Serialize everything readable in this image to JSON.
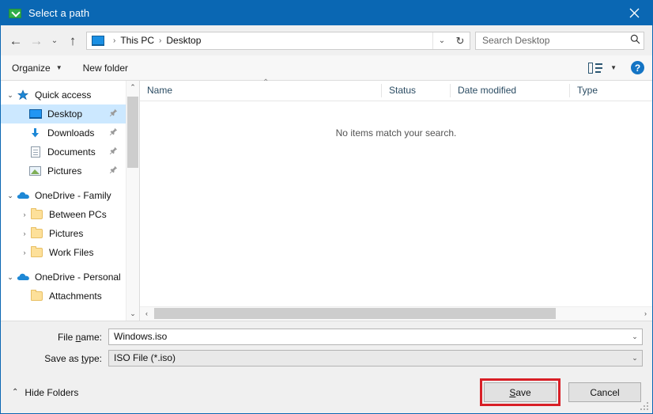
{
  "window": {
    "title": "Select a path",
    "icon": "save-arrow-icon",
    "close_label": "✕",
    "title_bar_color": "#0a67b3"
  },
  "address_bar": {
    "back_icon": "←",
    "forward_icon": "→",
    "recent_icon": "⌄",
    "up_icon": "↑",
    "breadcrumb": {
      "root_icon": "this-pc-monitor-icon",
      "separator": "›",
      "items": [
        "This PC",
        "Desktop"
      ]
    },
    "dropdown_icon": "⌄",
    "refresh_icon": "↻",
    "search": {
      "placeholder": "Search Desktop",
      "value": "",
      "icon": "⌕"
    }
  },
  "toolbar": {
    "organize_label": "Organize",
    "organize_caret": "▼",
    "new_folder_label": "New folder",
    "view_icon": "view-details-icon",
    "view_caret": "▼",
    "help_label": "?"
  },
  "sidebar": {
    "scroll_up_icon": "⌃",
    "scroll_down_icon": "⌄",
    "items": [
      {
        "label": "Quick access",
        "icon": "star-icon",
        "expander": "⌄",
        "indent": 0,
        "selected": false,
        "pinned": false
      },
      {
        "label": "Desktop",
        "icon": "monitor-icon",
        "expander": "",
        "indent": 1,
        "selected": true,
        "pinned": true
      },
      {
        "label": "Downloads",
        "icon": "download-icon",
        "expander": "",
        "indent": 1,
        "selected": false,
        "pinned": true
      },
      {
        "label": "Documents",
        "icon": "document-icon",
        "expander": "",
        "indent": 1,
        "selected": false,
        "pinned": true
      },
      {
        "label": "Pictures",
        "icon": "picture-icon",
        "expander": "",
        "indent": 1,
        "selected": false,
        "pinned": true
      },
      {
        "label": "OneDrive - Family",
        "icon": "cloud-icon",
        "expander": "⌄",
        "indent": 0,
        "selected": false,
        "pinned": false
      },
      {
        "label": "Between PCs",
        "icon": "folder-icon",
        "expander": "›",
        "indent": 2,
        "selected": false,
        "pinned": false
      },
      {
        "label": "Pictures",
        "icon": "folder-icon",
        "expander": "›",
        "indent": 2,
        "selected": false,
        "pinned": false
      },
      {
        "label": "Work Files",
        "icon": "folder-icon",
        "expander": "›",
        "indent": 2,
        "selected": false,
        "pinned": false
      },
      {
        "label": "OneDrive - Personal",
        "icon": "cloud-icon",
        "expander": "⌄",
        "indent": 0,
        "selected": false,
        "pinned": false
      },
      {
        "label": "Attachments",
        "icon": "folder-icon",
        "expander": "",
        "indent": 2,
        "selected": false,
        "pinned": false
      }
    ],
    "pin_icon": "📌"
  },
  "file_list": {
    "columns": [
      "Name",
      "Status",
      "Date modified",
      "Type"
    ],
    "sort_caret": "⌃",
    "empty_message": "No items match your search.",
    "rows": [],
    "hscroll_left_icon": "‹",
    "hscroll_right_icon": "›"
  },
  "form": {
    "file_name": {
      "label_pre": "File ",
      "label_underlined": "n",
      "label_post": "ame:",
      "value": "Windows.iso",
      "dropdown_icon": "⌄"
    },
    "save_as_type": {
      "label_pre": "Save as ",
      "label_underlined": "t",
      "label_post": "ype:",
      "value": "ISO File (*.iso)",
      "dropdown_icon": "⌄"
    }
  },
  "footer": {
    "hide_folders_label": "Hide Folders",
    "hide_folders_caret": "⌃",
    "save_pre": "",
    "save_underlined": "S",
    "save_post": "ave",
    "cancel_label": "Cancel",
    "highlight_color": "#d81f26"
  }
}
